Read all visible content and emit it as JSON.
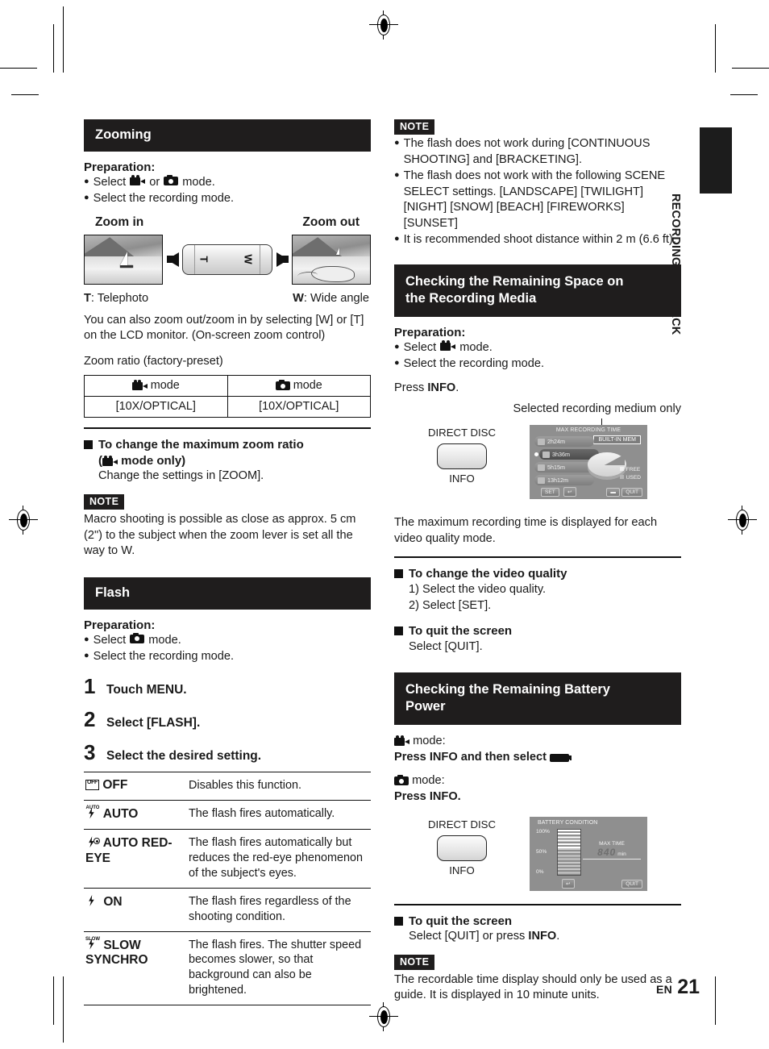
{
  "side_tab": {
    "label": "RECORDING/PLAYBACK"
  },
  "footer": {
    "lang": "EN",
    "page": "21"
  },
  "left_column": {
    "zooming": {
      "heading": "Zooming",
      "preparation_title": "Preparation:",
      "prep_1_pre": "Select",
      "prep_1_mid": "or",
      "prep_1_post": "mode.",
      "prep_2": "Select the recording mode.",
      "zoom_in_label": "Zoom in",
      "zoom_out_label": "Zoom out",
      "lever_t": "T",
      "lever_w": "W",
      "t_legend_key": "T",
      "t_legend_text": ": Telephoto",
      "w_legend_key": "W",
      "w_legend_text": ": Wide angle",
      "body": "You can also zoom out/zoom in by selecting [W] or [T] on the LCD monitor. (On-screen zoom control)",
      "ratio_caption": "Zoom ratio (factory-preset)",
      "ratio_table": {
        "header_suffix": "mode",
        "values": [
          "[10X/OPTICAL]",
          "[10X/OPTICAL]"
        ]
      },
      "change_head_line1": "To change the maximum zoom ratio",
      "change_head_line2_pre": "(",
      "change_head_line2_post": "mode only)",
      "change_sub": "Change the settings in [ZOOM].",
      "note_tag": "NOTE",
      "note_body": "Macro shooting is possible as close as approx. 5 cm (2\") to the subject when the zoom lever is set all the way to W."
    },
    "flash": {
      "heading": "Flash",
      "preparation_title": "Preparation:",
      "prep_1_pre": "Select",
      "prep_1_post": "mode.",
      "prep_2": "Select the recording mode.",
      "steps": [
        {
          "num": "1",
          "text": "Touch MENU."
        },
        {
          "num": "2",
          "text": "Select [FLASH]."
        },
        {
          "num": "3",
          "text": "Select the desired setting."
        }
      ],
      "settings": [
        {
          "icon": "flash-off-icon",
          "label": "OFF",
          "desc": "Disables this function."
        },
        {
          "icon": "flash-auto-icon",
          "label": "AUTO",
          "desc": "The flash fires automatically."
        },
        {
          "icon": "flash-auto-redeye-icon",
          "label": "AUTO RED-EYE",
          "desc": "The flash fires automatically but reduces the red-eye phenomenon of the subject's eyes."
        },
        {
          "icon": "flash-on-icon",
          "label": "ON",
          "desc": "The flash fires regardless of the shooting condition."
        },
        {
          "icon": "flash-slow-synchro-icon",
          "label": "SLOW SYNCHRO",
          "desc": "The flash fires. The shutter speed becomes slower, so that background can also be brightened."
        }
      ]
    }
  },
  "right_column": {
    "flash_note": {
      "note_tag": "NOTE",
      "items": [
        "The flash does not work during [CONTINUOUS SHOOTING] and [BRACKETING].",
        "The flash does not work with the following SCENE SELECT settings. [LANDSCAPE] [TWILIGHT] [NIGHT] [SNOW] [BEACH] [FIREWORKS] [SUNSET]",
        "It is recommended shoot distance within 2 m (6.6 ft)."
      ]
    },
    "remaining_space": {
      "heading_line1": "Checking the Remaining Space on",
      "heading_line2": "the Recording Media",
      "preparation_title": "Preparation:",
      "prep_1_pre": "Select",
      "prep_1_post": "mode.",
      "prep_2": "Select the recording mode.",
      "press_pre": "Press ",
      "press_key": "INFO",
      "press_post": ".",
      "callout": "Selected recording medium only",
      "button_top_label": "DIRECT DISC",
      "button_bottom_label": "INFO",
      "lcd": {
        "title": "MAX RECORDING TIME",
        "medium": "BUILT-IN MEM",
        "rows": [
          "2h24m",
          "3h36m",
          "5h15m",
          "13h12m"
        ],
        "selected_index": 1,
        "legend_free": "FREE",
        "legend_used": "USED",
        "softkey_set": "SET",
        "softkey_back": "↩",
        "softkey_batt": "▬",
        "softkey_quit": "QUIT"
      },
      "body": "The maximum recording time is displayed for each video quality mode.",
      "change_quality_head": "To change the video quality",
      "change_quality_1": "1) Select the video quality.",
      "change_quality_2": "2) Select [SET].",
      "quit_head": "To quit the screen",
      "quit_sub": "Select [QUIT]."
    },
    "remaining_battery": {
      "heading_line1": "Checking the Remaining Battery",
      "heading_line2": "Power",
      "video_mode_suffix": "mode:",
      "video_instruction_pre": "Press INFO and then select",
      "video_instruction_post": ".",
      "still_mode_suffix": "mode:",
      "still_instruction": "Press INFO.",
      "button_top_label": "DIRECT DISC",
      "button_bottom_label": "INFO",
      "lcd": {
        "title": "BATTERY CONDITION",
        "pct_100": "100%",
        "pct_50": "50%",
        "pct_0": "0%",
        "max_time_label": "MAX TIME",
        "max_time_value": "840",
        "max_time_unit": "min",
        "softkey_back": "↩",
        "softkey_quit": "QUIT"
      },
      "quit_head": "To quit the screen",
      "quit_sub_pre": "Select [QUIT] or press ",
      "quit_sub_key": "INFO",
      "quit_sub_post": ".",
      "note_tag": "NOTE",
      "note_body": "The recordable time display should only be used as a guide. It is displayed in 10 minute units."
    }
  }
}
